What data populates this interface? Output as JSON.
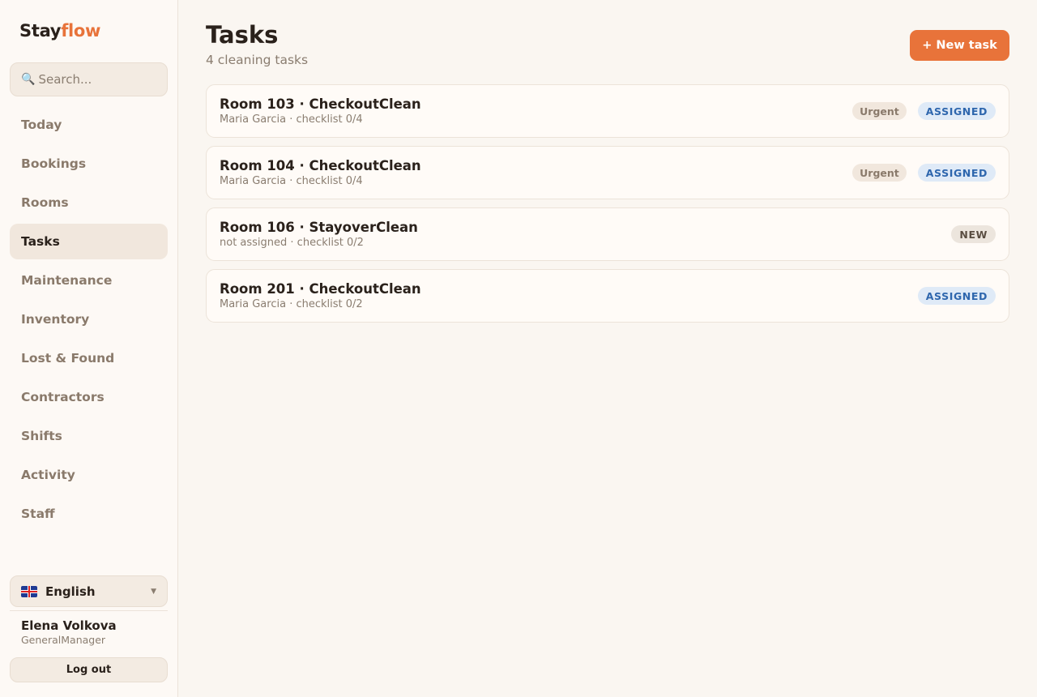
{
  "app": {
    "logo_main": "Stay",
    "logo_accent": "flow"
  },
  "colors": {
    "accent": "#e8733a",
    "assigned": "#2e66ad",
    "background": "#faf6f1"
  },
  "sidebar": {
    "search_icon": "search-icon",
    "search_placeholder": "Search...",
    "items": [
      {
        "label": "Today",
        "active": false
      },
      {
        "label": "Bookings",
        "active": false
      },
      {
        "label": "Rooms",
        "active": false
      },
      {
        "label": "Tasks",
        "active": true
      },
      {
        "label": "Maintenance",
        "active": false
      },
      {
        "label": "Inventory",
        "active": false
      },
      {
        "label": "Lost & Found",
        "active": false
      },
      {
        "label": "Contractors",
        "active": false
      },
      {
        "label": "Shifts",
        "active": false
      },
      {
        "label": "Activity",
        "active": false
      },
      {
        "label": "Staff",
        "active": false
      }
    ],
    "language": {
      "label": "English",
      "flag": "uk-flag-icon"
    },
    "user": {
      "name": "Elena Volkova",
      "role": "GeneralManager"
    },
    "logout_label": "Log out"
  },
  "main": {
    "title": "Tasks",
    "subtitle": "4 cleaning tasks",
    "new_task_label": "+ New task",
    "tasks": [
      {
        "title": "Room 103 · CheckoutClean",
        "meta": "Maria Garcia · checklist 0/4",
        "priority": "Urgent",
        "status": "ASSIGNED",
        "status_type": "assigned"
      },
      {
        "title": "Room 104 · CheckoutClean",
        "meta": "Maria Garcia · checklist 0/4",
        "priority": "Urgent",
        "status": "ASSIGNED",
        "status_type": "assigned"
      },
      {
        "title": "Room 106 · StayoverClean",
        "meta": "not assigned · checklist 0/2",
        "priority": null,
        "status": "NEW",
        "status_type": "new"
      },
      {
        "title": "Room 201 · CheckoutClean",
        "meta": "Maria Garcia · checklist 0/2",
        "priority": null,
        "status": "ASSIGNED",
        "status_type": "assigned"
      }
    ]
  }
}
